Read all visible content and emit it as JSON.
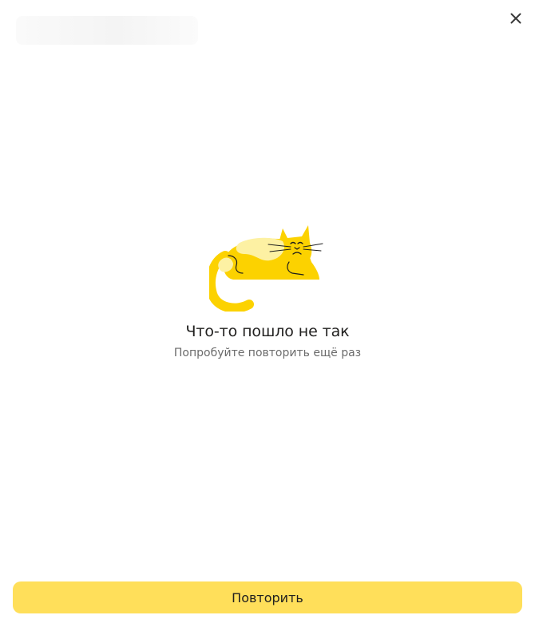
{
  "header": {
    "close_icon": "close-icon"
  },
  "error": {
    "illustration": "sad-cat-icon",
    "title": "Что-то пошло не так",
    "subtitle": "Попробуйте повторить ещё раз"
  },
  "actions": {
    "retry_label": "Повторить"
  },
  "colors": {
    "accent": "#ffdf5a",
    "cat_body": "#fcd200",
    "cat_spots": "#fdf1a3",
    "title_text": "#21201f",
    "subtitle_text": "#6b6b6b"
  }
}
